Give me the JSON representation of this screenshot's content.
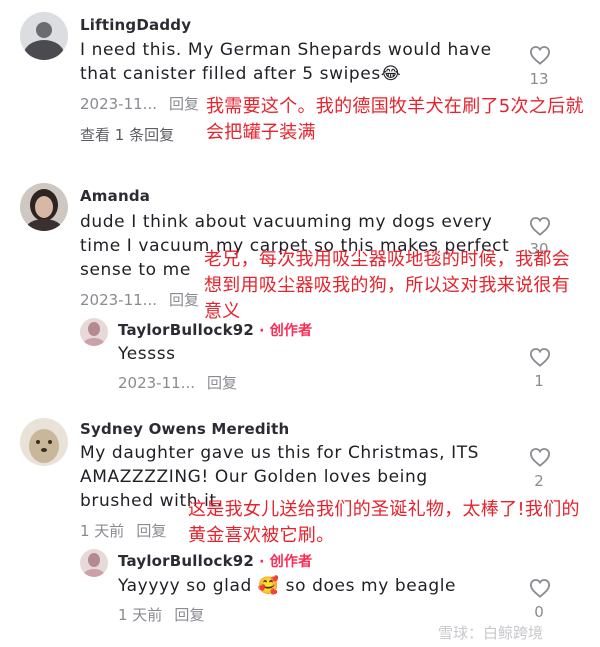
{
  "comments": [
    {
      "username": "LiftingDaddy",
      "text": "I need this. My German Shepards would have that canister filled after 5 swipes😂",
      "time": "2023-11...",
      "reply_label": "回复",
      "likes": "13",
      "view_replies": "查看 1 条回复",
      "translation": "我需要这个。我的德国牧羊犬在刷了5次之后就会把罐子装满"
    },
    {
      "username": "Amanda",
      "text": "dude I think about vacuuming my dogs every time I vacuum my carpet so this makes perfect sense to me",
      "time": "2023-11...",
      "reply_label": "回复",
      "likes": "30",
      "translation": "老兄，每次我用吸尘器吸地毯的时候，我都会想到用吸尘器吸我的狗，所以这对我来说很有意义",
      "reply": {
        "username": "TaylorBullock92",
        "creator_sep": " · ",
        "creator_label": "创作者",
        "text": "Yessss",
        "time": "2023-11...",
        "reply_label": "回复",
        "likes": "1"
      }
    },
    {
      "username": "Sydney Owens Meredith",
      "text": "My daughter gave us this for Christmas, ITS AMAZZZZING! Our Golden loves being brushed with it.",
      "time": "1 天前",
      "reply_label": "回复",
      "likes": "2",
      "translation": "这是我女儿送给我们的圣诞礼物，太棒了!我们的黄金喜欢被它刷。",
      "reply": {
        "username": "TaylorBullock92",
        "creator_sep": " · ",
        "creator_label": "创作者",
        "text": "Yayyyy so glad 🥰 so does my beagle",
        "time": "1 天前",
        "reply_label": "回复",
        "likes": "0"
      }
    }
  ],
  "watermark": "雪球：白鲸跨境",
  "colors": {
    "annotation": "#e8222b",
    "creator": "#fe2c55",
    "meta": "#8a8b91"
  }
}
